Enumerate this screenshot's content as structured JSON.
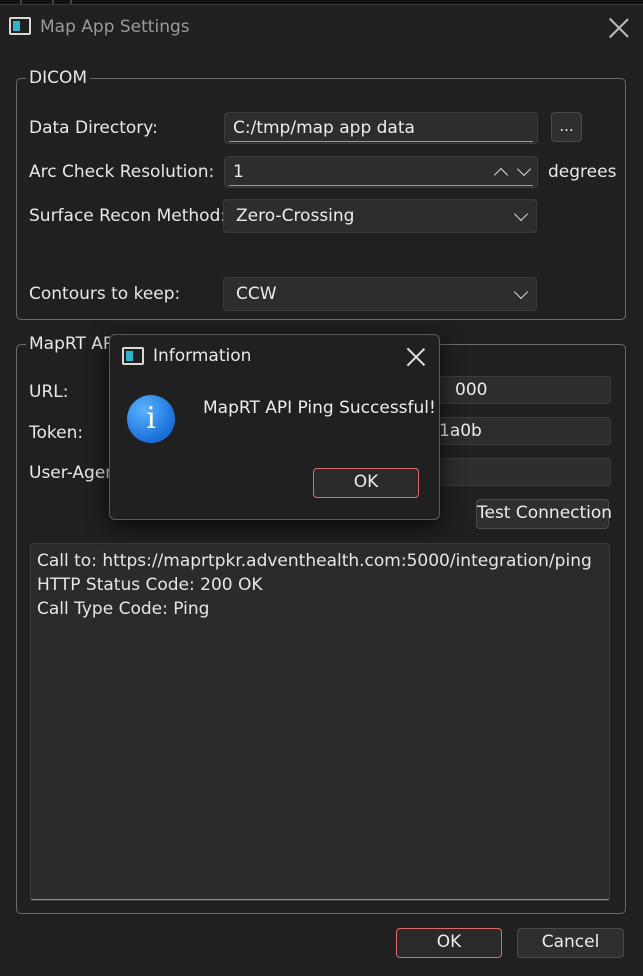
{
  "window": {
    "title": "Map App Settings"
  },
  "dicom": {
    "legend": "DICOM",
    "data_directory": {
      "label": "Data Directory:",
      "value": "C:/tmp/map app data",
      "browse_label": "..."
    },
    "arc_check": {
      "label": "Arc Check Resolution:",
      "value": "1",
      "unit": "degrees"
    },
    "surface_recon": {
      "label": "Surface Recon Method:",
      "selected": "Zero-Crossing"
    },
    "contours": {
      "label": "Contours to keep:",
      "selected": "CCW"
    }
  },
  "maprt_api": {
    "legend": "MapRT API",
    "url": {
      "label": "URL:",
      "value_visible_tail": "000"
    },
    "token": {
      "label": "Token:",
      "value_visible_tail": "1a0b"
    },
    "user_agent": {
      "label": "User-Agent",
      "value": ""
    },
    "test_button": "Test Connection",
    "log_lines": [
      "Call to: https://maprtpkr.adventhealth.com:5000/integration/ping",
      "HTTP Status Code: 200 OK",
      "Call Type Code: Ping"
    ]
  },
  "footer": {
    "ok_label": "OK",
    "cancel_label": "Cancel"
  },
  "dialog": {
    "title": "Information",
    "icon_letter": "i",
    "message": "MapRT API Ping Successful!",
    "ok_label": "OK"
  },
  "colors": {
    "accent_border": "#e06a6a",
    "info_icon": "#1a6fd8",
    "window_bg": "#202020"
  }
}
